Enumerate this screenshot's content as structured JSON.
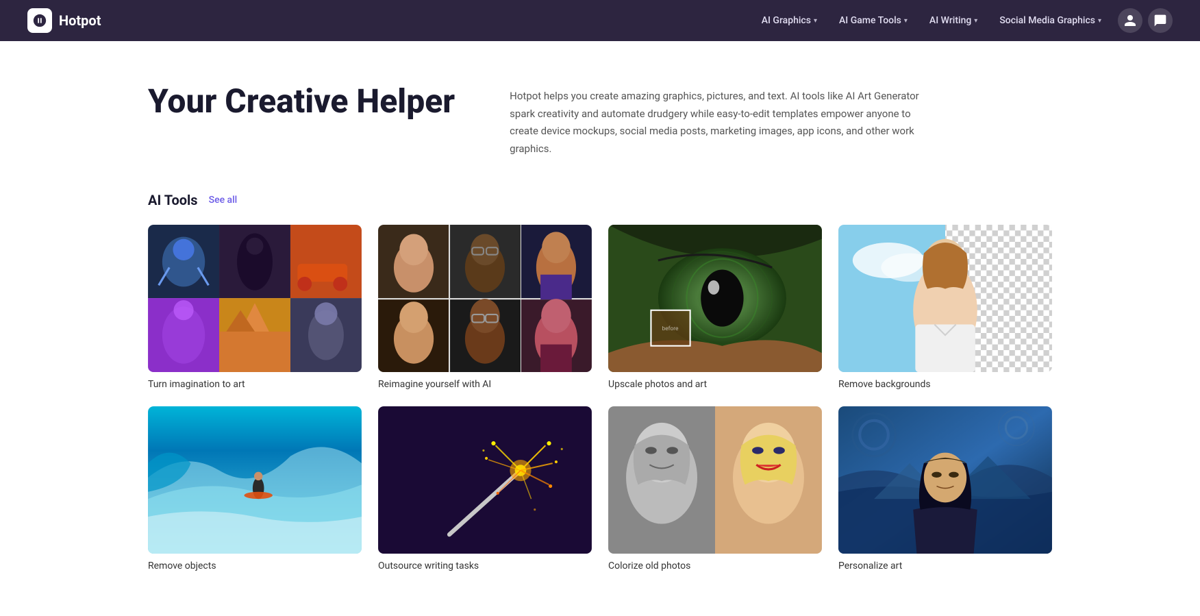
{
  "nav": {
    "logo_text": "Hotpot",
    "logo_icon": "🤖",
    "links": [
      {
        "id": "ai-graphics",
        "label": "AI Graphics",
        "has_dropdown": true
      },
      {
        "id": "ai-game-tools",
        "label": "AI Game Tools",
        "has_dropdown": true
      },
      {
        "id": "ai-writing",
        "label": "AI Writing",
        "has_dropdown": true
      },
      {
        "id": "social-media-graphics",
        "label": "Social Media Graphics",
        "has_dropdown": true
      }
    ]
  },
  "hero": {
    "title": "Your Creative Helper",
    "description": "Hotpot helps you create amazing graphics, pictures, and text. AI tools like AI Art Generator spark creativity and automate drudgery while easy-to-edit templates empower anyone to create device mockups, social media posts, marketing images, app icons, and other work graphics."
  },
  "ai_tools_section": {
    "title": "AI Tools",
    "see_all_label": "See all",
    "tools": [
      {
        "id": "turn-imagination",
        "label": "Turn imagination to art"
      },
      {
        "id": "reimagine-yourself",
        "label": "Reimagine yourself with AI"
      },
      {
        "id": "upscale-photos",
        "label": "Upscale photos and art"
      },
      {
        "id": "remove-backgrounds",
        "label": "Remove backgrounds"
      },
      {
        "id": "remove-objects",
        "label": "Remove objects"
      },
      {
        "id": "outsource-writing",
        "label": "Outsource writing tasks"
      },
      {
        "id": "colorize-photos",
        "label": "Colorize old photos"
      },
      {
        "id": "personalize-art",
        "label": "Personalize art"
      }
    ]
  }
}
